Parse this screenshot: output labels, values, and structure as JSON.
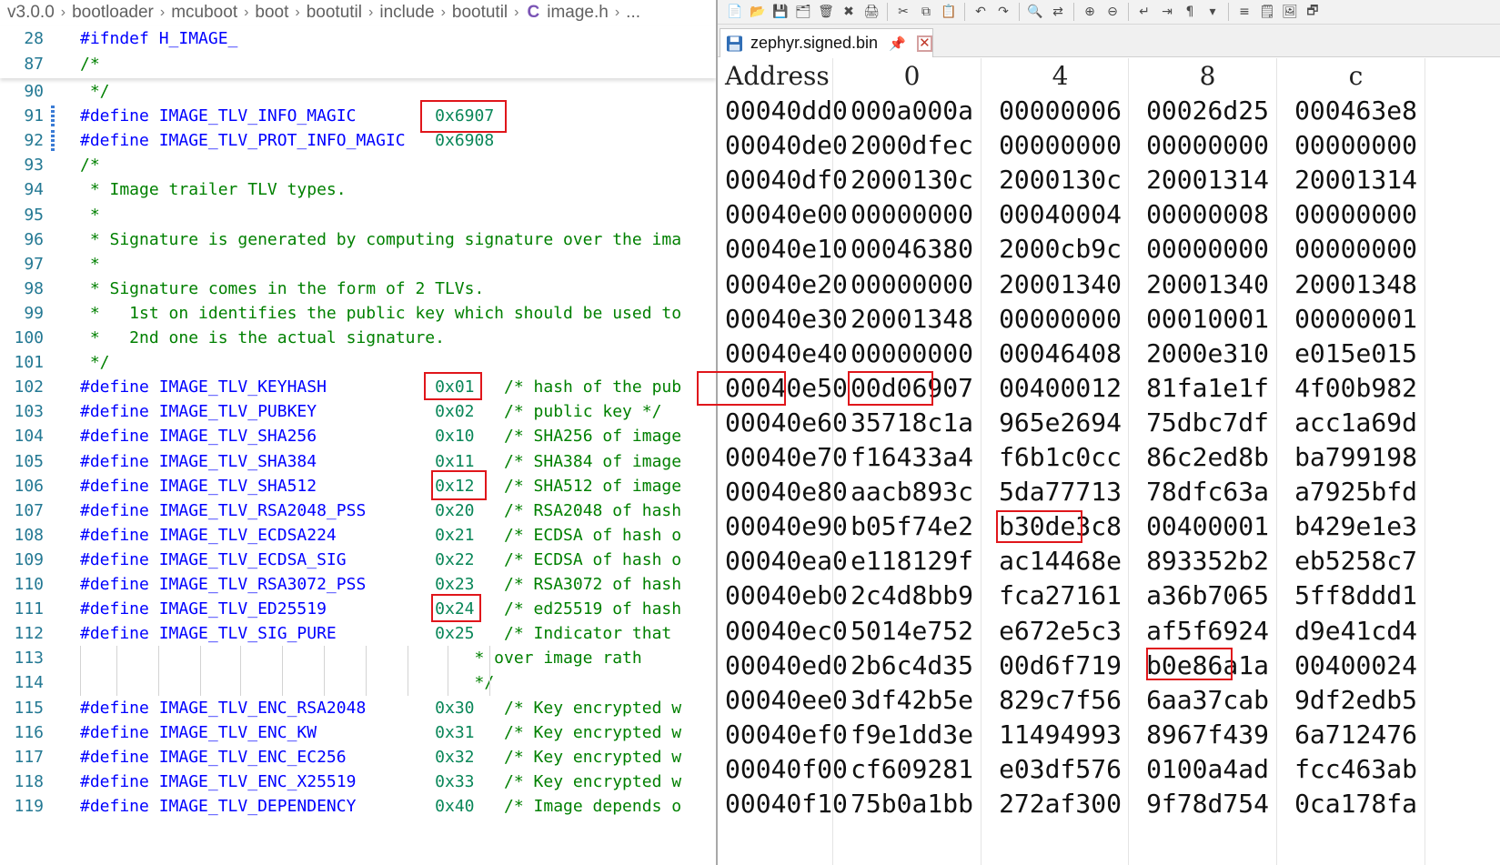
{
  "breadcrumb": [
    "v3.0.0",
    "bootloader",
    "mcuboot",
    "boot",
    "bootutil",
    "include",
    "bootutil"
  ],
  "breadcrumb_file_icon": "C",
  "breadcrumb_file": "image.h",
  "breadcrumb_trailing": "...",
  "sticky_lines": [
    {
      "num": "28",
      "parts": [
        [
          "pp",
          "#ifndef "
        ],
        [
          "mac",
          "H_IMAGE_"
        ]
      ]
    },
    {
      "num": "87",
      "parts": [
        [
          "cm",
          "/*"
        ]
      ]
    }
  ],
  "code_lines": [
    {
      "num": "90",
      "parts": [
        [
          "cm",
          " */"
        ]
      ]
    },
    {
      "num": "91",
      "parts": [
        [
          "pp",
          "#define "
        ],
        [
          "mac",
          "IMAGE_TLV_INFO_MAGIC        "
        ],
        [
          "num",
          "0x6907"
        ]
      ]
    },
    {
      "num": "92",
      "parts": [
        [
          "pp",
          "#define "
        ],
        [
          "mac",
          "IMAGE_TLV_PROT_INFO_MAGIC   "
        ],
        [
          "num",
          "0x6908"
        ]
      ]
    },
    {
      "num": "93",
      "parts": [
        [
          "cm",
          "/*"
        ]
      ]
    },
    {
      "num": "94",
      "parts": [
        [
          "cm",
          " * Image trailer TLV types."
        ]
      ]
    },
    {
      "num": "95",
      "parts": [
        [
          "cm",
          " *"
        ]
      ]
    },
    {
      "num": "96",
      "parts": [
        [
          "cm",
          " * Signature is generated by computing signature over the ima"
        ]
      ]
    },
    {
      "num": "97",
      "parts": [
        [
          "cm",
          " *"
        ]
      ]
    },
    {
      "num": "98",
      "parts": [
        [
          "cm",
          " * Signature comes in the form of 2 TLVs."
        ]
      ]
    },
    {
      "num": "99",
      "parts": [
        [
          "cm",
          " *   1st on identifies the public key which should be used to"
        ]
      ]
    },
    {
      "num": "100",
      "parts": [
        [
          "cm",
          " *   2nd one is the actual signature."
        ]
      ]
    },
    {
      "num": "101",
      "parts": [
        [
          "cm",
          " */"
        ]
      ]
    },
    {
      "num": "102",
      "parts": [
        [
          "pp",
          "#define "
        ],
        [
          "mac",
          "IMAGE_TLV_KEYHASH           "
        ],
        [
          "num",
          "0x01"
        ],
        [
          "cm",
          "   /* hash of the pub"
        ]
      ]
    },
    {
      "num": "103",
      "parts": [
        [
          "pp",
          "#define "
        ],
        [
          "mac",
          "IMAGE_TLV_PUBKEY            "
        ],
        [
          "num",
          "0x02"
        ],
        [
          "cm",
          "   /* public key */"
        ]
      ]
    },
    {
      "num": "104",
      "parts": [
        [
          "pp",
          "#define "
        ],
        [
          "mac",
          "IMAGE_TLV_SHA256            "
        ],
        [
          "num",
          "0x10"
        ],
        [
          "cm",
          "   /* SHA256 of image"
        ]
      ]
    },
    {
      "num": "105",
      "parts": [
        [
          "pp",
          "#define "
        ],
        [
          "mac",
          "IMAGE_TLV_SHA384            "
        ],
        [
          "num",
          "0x11"
        ],
        [
          "cm",
          "   /* SHA384 of image"
        ]
      ]
    },
    {
      "num": "106",
      "parts": [
        [
          "pp",
          "#define "
        ],
        [
          "mac",
          "IMAGE_TLV_SHA512            "
        ],
        [
          "num",
          "0x12"
        ],
        [
          "cm",
          "   /* SHA512 of image"
        ]
      ]
    },
    {
      "num": "107",
      "parts": [
        [
          "pp",
          "#define "
        ],
        [
          "mac",
          "IMAGE_TLV_RSA2048_PSS       "
        ],
        [
          "num",
          "0x20"
        ],
        [
          "cm",
          "   /* RSA2048 of hash"
        ]
      ]
    },
    {
      "num": "108",
      "parts": [
        [
          "pp",
          "#define "
        ],
        [
          "mac",
          "IMAGE_TLV_ECDSA224          "
        ],
        [
          "num",
          "0x21"
        ],
        [
          "cm",
          "   /* ECDSA of hash o"
        ]
      ]
    },
    {
      "num": "109",
      "parts": [
        [
          "pp",
          "#define "
        ],
        [
          "mac",
          "IMAGE_TLV_ECDSA_SIG         "
        ],
        [
          "num",
          "0x22"
        ],
        [
          "cm",
          "   /* ECDSA of hash o"
        ]
      ]
    },
    {
      "num": "110",
      "parts": [
        [
          "pp",
          "#define "
        ],
        [
          "mac",
          "IMAGE_TLV_RSA3072_PSS       "
        ],
        [
          "num",
          "0x23"
        ],
        [
          "cm",
          "   /* RSA3072 of hash"
        ]
      ]
    },
    {
      "num": "111",
      "parts": [
        [
          "pp",
          "#define "
        ],
        [
          "mac",
          "IMAGE_TLV_ED25519           "
        ],
        [
          "num",
          "0x24"
        ],
        [
          "cm",
          "   /* ed25519 of hash"
        ]
      ]
    },
    {
      "num": "112",
      "parts": [
        [
          "pp",
          "#define "
        ],
        [
          "mac",
          "IMAGE_TLV_SIG_PURE          "
        ],
        [
          "num",
          "0x25"
        ],
        [
          "cm",
          "   /* Indicator that"
        ]
      ]
    },
    {
      "num": "113",
      "parts": [
        [
          "cm",
          "                                        * over image rath"
        ]
      ]
    },
    {
      "num": "114",
      "parts": [
        [
          "cm",
          "                                        */"
        ]
      ]
    },
    {
      "num": "115",
      "parts": [
        [
          "pp",
          "#define "
        ],
        [
          "mac",
          "IMAGE_TLV_ENC_RSA2048       "
        ],
        [
          "num",
          "0x30"
        ],
        [
          "cm",
          "   /* Key encrypted w"
        ]
      ]
    },
    {
      "num": "116",
      "parts": [
        [
          "pp",
          "#define "
        ],
        [
          "mac",
          "IMAGE_TLV_ENC_KW            "
        ],
        [
          "num",
          "0x31"
        ],
        [
          "cm",
          "   /* Key encrypted w"
        ]
      ]
    },
    {
      "num": "117",
      "parts": [
        [
          "pp",
          "#define "
        ],
        [
          "mac",
          "IMAGE_TLV_ENC_EC256         "
        ],
        [
          "num",
          "0x32"
        ],
        [
          "cm",
          "   /* Key encrypted w"
        ]
      ]
    },
    {
      "num": "118",
      "parts": [
        [
          "pp",
          "#define "
        ],
        [
          "mac",
          "IMAGE_TLV_ENC_X25519        "
        ],
        [
          "num",
          "0x33"
        ],
        [
          "cm",
          "   /* Key encrypted w"
        ]
      ]
    },
    {
      "num": "119",
      "parts": [
        [
          "pp",
          "#define "
        ],
        [
          "mac",
          "IMAGE_TLV_DEPENDENCY        "
        ],
        [
          "num",
          "0x40"
        ],
        [
          "cm",
          "   /* Image depends o"
        ]
      ]
    }
  ],
  "hex": {
    "tab_name": "zephyr.signed.bin",
    "toolbar_icons": [
      "new-file-icon",
      "open-folder-icon",
      "save-icon",
      "save-all-icon",
      "close-file-icon",
      "close-all-icon",
      "print-icon",
      "cut-icon",
      "copy-icon",
      "paste-icon",
      "undo-icon",
      "redo-icon",
      "find-icon",
      "replace-icon",
      "zoom-in-icon",
      "zoom-out-icon",
      "wrap-icon",
      "indent-icon",
      "pilcrow-icon",
      "dropdown-icon",
      "word-wrap-icon",
      "note-icon",
      "image-icon",
      "window-icon"
    ],
    "header": {
      "address": "Address",
      "cols": [
        "0",
        "4",
        "8",
        "c"
      ]
    },
    "rows": [
      [
        "00040dd0",
        "000a000a",
        "00000006",
        "00026d25",
        "000463e8"
      ],
      [
        "00040de0",
        "2000dfec",
        "00000000",
        "00000000",
        "00000000"
      ],
      [
        "00040df0",
        "2000130c",
        "2000130c",
        "20001314",
        "20001314"
      ],
      [
        "00040e00",
        "00000000",
        "00040004",
        "00000008",
        "00000000"
      ],
      [
        "00040e10",
        "00046380",
        "2000cb9c",
        "00000000",
        "00000000"
      ],
      [
        "00040e20",
        "00000000",
        "20001340",
        "20001340",
        "20001348"
      ],
      [
        "00040e30",
        "20001348",
        "00000000",
        "00010001",
        "00000001"
      ],
      [
        "00040e40",
        "00000000",
        "00046408",
        "2000e310",
        "e015e015"
      ],
      [
        "00040e50",
        "00d06907",
        "00400012",
        "81fa1e1f",
        "4f00b982"
      ],
      [
        "00040e60",
        "35718c1a",
        "965e2694",
        "75dbc7df",
        "acc1a69d"
      ],
      [
        "00040e70",
        "f16433a4",
        "f6b1c0cc",
        "86c2ed8b",
        "ba799198"
      ],
      [
        "00040e80",
        "aacb893c",
        "5da77713",
        "78dfc63a",
        "a7925bfd"
      ],
      [
        "00040e90",
        "b05f74e2",
        "b30de3c8",
        "00400001",
        "b429e1e3"
      ],
      [
        "00040ea0",
        "e118129f",
        "ac14468e",
        "893352b2",
        "eb5258c7"
      ],
      [
        "00040eb0",
        "2c4d8bb9",
        "fca27161",
        "a36b7065",
        "5ff8ddd1"
      ],
      [
        "00040ec0",
        "5014e752",
        "e672e5c3",
        "af5f6924",
        "d9e41cd4"
      ],
      [
        "00040ed0",
        "2b6c4d35",
        "00d6f719",
        "b0e86a1a",
        "00400024"
      ],
      [
        "00040ee0",
        "3df42b5e",
        "829c7f56",
        "6aa37cab",
        "9df2edb5"
      ],
      [
        "00040ef0",
        "f9e1dd3e",
        "11494993",
        "8967f439",
        "6a712476"
      ],
      [
        "00040f00",
        "cf609281",
        "e03df576",
        "0100a4ad",
        "fcc463ab"
      ],
      [
        "00040f10",
        "75b0a1bb",
        "272af300",
        "9f78d754",
        "0ca178fa"
      ]
    ]
  },
  "colors": {
    "highlight": "#e0161b",
    "keyword": "#0000ff",
    "number": "#098658",
    "comment": "#008000",
    "line_number": "#237893"
  }
}
